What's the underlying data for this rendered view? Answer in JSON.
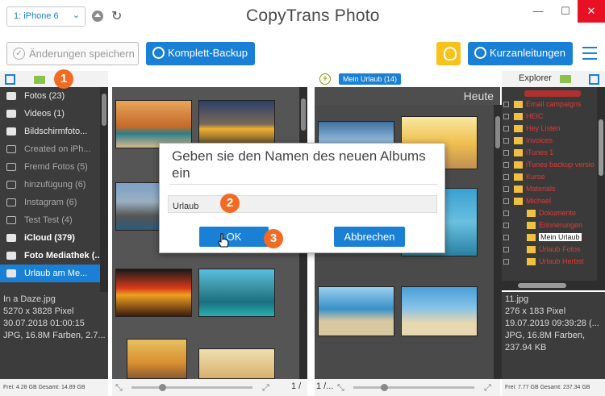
{
  "device": {
    "selected": "1: iPhone 6"
  },
  "app": {
    "title": "CopyTrans Photo"
  },
  "window_controls": {
    "minimize": "—",
    "maximize": "☐",
    "close": "✕"
  },
  "toolbar": {
    "save_label": "Änderungen speichern",
    "backup_label": "Komplett-Backup",
    "guides_label": "Kurzanleitungen"
  },
  "left_pane": {
    "albums": [
      {
        "label": "Fotos (23)",
        "icon": "camera-icon",
        "style": "normal"
      },
      {
        "label": "Videos (1)",
        "icon": "video-icon",
        "style": "normal"
      },
      {
        "label": "Bildschirmfoto...",
        "icon": "screenshot-icon",
        "style": "normal"
      },
      {
        "label": "Created on iPh...",
        "icon": "album-icon",
        "style": "dim"
      },
      {
        "label": "Fremd Fotos (5)",
        "icon": "album-icon",
        "style": "dim"
      },
      {
        "label": "hinzufügung (6)",
        "icon": "album-icon",
        "style": "dim"
      },
      {
        "label": "Instagram (6)",
        "icon": "album-icon",
        "style": "dim"
      },
      {
        "label": "Test Test (4)",
        "icon": "album-icon",
        "style": "dim"
      },
      {
        "label": "iCloud (379)",
        "icon": "cloud-icon",
        "style": "bold"
      },
      {
        "label": "Foto Mediathek (...",
        "icon": "camera-icon",
        "style": "bold"
      },
      {
        "label": "Urlaub am Me...",
        "icon": "album-icon",
        "style": "sel"
      }
    ],
    "info": {
      "filename": "In a Daze.jpg",
      "dimensions": "5270 x 3828 Pixel",
      "date": "30.07.2018 01:00:15",
      "details": "JPG, 16.8M Farben, 2.7..."
    },
    "status": "Frei: 4.28 GB Gesamt: 14.89 GB"
  },
  "middle_pane": {
    "album_tag": "Mein Urlaub (14)",
    "heading": "Heute",
    "page_indicator": "1 /..."
  },
  "left_photo_pane": {
    "page_indicator": "1 / ..."
  },
  "right_pane": {
    "explorer_label": "Explorer",
    "tree": [
      {
        "label": "Email campaigns",
        "level": 0
      },
      {
        "label": "HEIC",
        "level": 0
      },
      {
        "label": "Hey Listen",
        "level": 0
      },
      {
        "label": "Invoices",
        "level": 0
      },
      {
        "label": "iTunes 1",
        "level": 0
      },
      {
        "label": "iTunes backup versio",
        "level": 0
      },
      {
        "label": "Kurse",
        "level": 0
      },
      {
        "label": "Materials",
        "level": 0
      },
      {
        "label": "Michael",
        "level": 0
      },
      {
        "label": "Dokumente",
        "level": 1
      },
      {
        "label": "Erinnerungen",
        "level": 1
      },
      {
        "label": "Mein Urlaub",
        "level": 1,
        "highlight": true
      },
      {
        "label": "Urlaub Fotos",
        "level": 1
      },
      {
        "label": "Urlaub Herbst",
        "level": 1
      }
    ],
    "info": {
      "filename": "11.jpg",
      "dimensions": "276 x 183 Pixel",
      "date": "19.07.2019 09:39:28 (...",
      "details": "JPG, 16.8M Farben, 237.94 KB"
    },
    "status": "Frei: 7.77 GB Gesamt: 237.34 GB"
  },
  "dialog": {
    "title": "Geben sie den Namen des neuen Albums ein",
    "input_value": "Urlaub",
    "ok_label": "OK",
    "cancel_label": "Abbrechen"
  },
  "badges": {
    "one": "1",
    "two": "2",
    "three": "3"
  },
  "colors": {
    "accent": "#1a80d6",
    "badge": "#f26b24",
    "tree_text": "#e53935",
    "bulb": "#f6c21b"
  }
}
